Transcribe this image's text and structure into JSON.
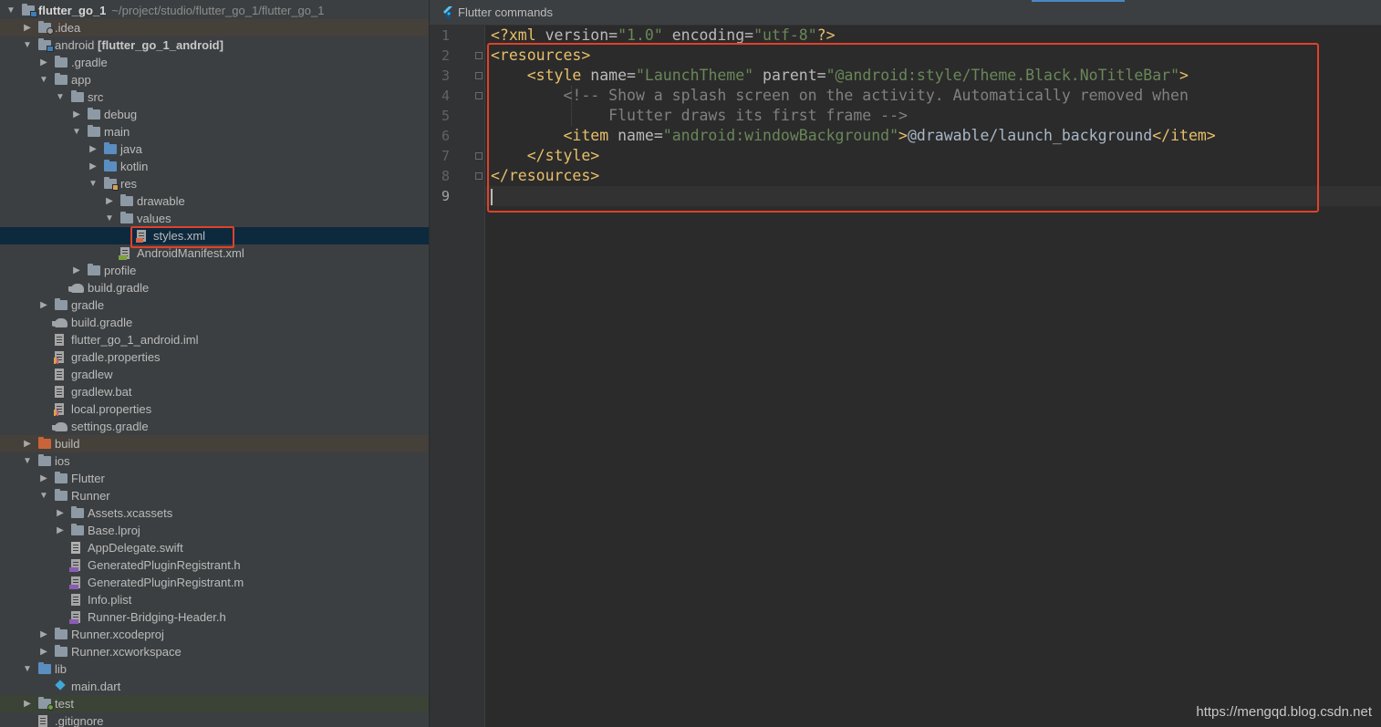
{
  "project_tree": {
    "rows": [
      {
        "label": "flutter_go_1",
        "sub": "~/project/studio/flutter_go_1/flutter_go_1",
        "bold": true,
        "depth": 0,
        "arrow": "open",
        "icon": "folder",
        "variant": "module",
        "state": ""
      },
      {
        "label": ".idea",
        "depth": 1,
        "arrow": "closed",
        "icon": "folder",
        "variant": "gear",
        "state": "excluded"
      },
      {
        "label": "android",
        "bracket": "[flutter_go_1_android]",
        "depth": 1,
        "arrow": "open",
        "icon": "folder",
        "variant": "module",
        "state": ""
      },
      {
        "label": ".gradle",
        "depth": 2,
        "arrow": "closed",
        "icon": "folder",
        "variant": "",
        "state": ""
      },
      {
        "label": "app",
        "depth": 2,
        "arrow": "open",
        "icon": "folder",
        "variant": "",
        "state": ""
      },
      {
        "label": "src",
        "depth": 3,
        "arrow": "open",
        "icon": "folder",
        "variant": "",
        "state": ""
      },
      {
        "label": "debug",
        "depth": 4,
        "arrow": "closed",
        "icon": "folder",
        "variant": "",
        "state": ""
      },
      {
        "label": "main",
        "depth": 4,
        "arrow": "open",
        "icon": "folder",
        "variant": "",
        "state": ""
      },
      {
        "label": "java",
        "depth": 5,
        "arrow": "closed",
        "icon": "folder",
        "variant": "blue",
        "state": ""
      },
      {
        "label": "kotlin",
        "depth": 5,
        "arrow": "closed",
        "icon": "folder",
        "variant": "blue",
        "state": ""
      },
      {
        "label": "res",
        "depth": 5,
        "arrow": "open",
        "icon": "folder",
        "variant": "res",
        "state": ""
      },
      {
        "label": "drawable",
        "depth": 6,
        "arrow": "closed",
        "icon": "folder",
        "variant": "",
        "state": ""
      },
      {
        "label": "values",
        "depth": 6,
        "arrow": "open",
        "icon": "folder",
        "variant": "",
        "state": ""
      },
      {
        "label": "styles.xml",
        "depth": 7,
        "arrow": "",
        "icon": "file",
        "variant": "xml",
        "state": "selected"
      },
      {
        "label": "AndroidManifest.xml",
        "depth": 6,
        "arrow": "",
        "icon": "file",
        "variant": "mf",
        "state": ""
      },
      {
        "label": "profile",
        "depth": 4,
        "arrow": "closed",
        "icon": "folder",
        "variant": "",
        "state": ""
      },
      {
        "label": "build.gradle",
        "depth": 3,
        "arrow": "",
        "icon": "elephant",
        "variant": "",
        "state": ""
      },
      {
        "label": "gradle",
        "depth": 2,
        "arrow": "closed",
        "icon": "folder",
        "variant": "",
        "state": ""
      },
      {
        "label": "build.gradle",
        "depth": 2,
        "arrow": "",
        "icon": "elephant",
        "variant": "",
        "state": ""
      },
      {
        "label": "flutter_go_1_android.iml",
        "depth": 2,
        "arrow": "",
        "icon": "file",
        "variant": "",
        "state": ""
      },
      {
        "label": "gradle.properties",
        "depth": 2,
        "arrow": "",
        "icon": "file",
        "variant": "chart",
        "state": ""
      },
      {
        "label": "gradlew",
        "depth": 2,
        "arrow": "",
        "icon": "file",
        "variant": "",
        "state": ""
      },
      {
        "label": "gradlew.bat",
        "depth": 2,
        "arrow": "",
        "icon": "file",
        "variant": "",
        "state": ""
      },
      {
        "label": "local.properties",
        "depth": 2,
        "arrow": "",
        "icon": "file",
        "variant": "chart",
        "state": ""
      },
      {
        "label": "settings.gradle",
        "depth": 2,
        "arrow": "",
        "icon": "elephant",
        "variant": "",
        "state": ""
      },
      {
        "label": "build",
        "depth": 1,
        "arrow": "closed",
        "icon": "folder",
        "variant": "orange",
        "state": "excluded"
      },
      {
        "label": "ios",
        "depth": 1,
        "arrow": "open",
        "icon": "folder",
        "variant": "",
        "state": ""
      },
      {
        "label": "Flutter",
        "depth": 2,
        "arrow": "closed",
        "icon": "folder",
        "variant": "",
        "state": ""
      },
      {
        "label": "Runner",
        "depth": 2,
        "arrow": "open",
        "icon": "folder",
        "variant": "",
        "state": ""
      },
      {
        "label": "Assets.xcassets",
        "depth": 3,
        "arrow": "closed",
        "icon": "folder",
        "variant": "",
        "state": ""
      },
      {
        "label": "Base.lproj",
        "depth": 3,
        "arrow": "closed",
        "icon": "folder",
        "variant": "",
        "state": ""
      },
      {
        "label": "AppDelegate.swift",
        "depth": 3,
        "arrow": "",
        "icon": "file",
        "variant": "swift",
        "state": ""
      },
      {
        "label": "GeneratedPluginRegistrant.h",
        "depth": 3,
        "arrow": "",
        "icon": "file",
        "variant": "hdr",
        "state": ""
      },
      {
        "label": "GeneratedPluginRegistrant.m",
        "depth": 3,
        "arrow": "",
        "icon": "file",
        "variant": "hdr",
        "state": ""
      },
      {
        "label": "Info.plist",
        "depth": 3,
        "arrow": "",
        "icon": "file",
        "variant": "",
        "state": ""
      },
      {
        "label": "Runner-Bridging-Header.h",
        "depth": 3,
        "arrow": "",
        "icon": "file",
        "variant": "hdr",
        "state": ""
      },
      {
        "label": "Runner.xcodeproj",
        "depth": 2,
        "arrow": "closed",
        "icon": "folder",
        "variant": "",
        "state": ""
      },
      {
        "label": "Runner.xcworkspace",
        "depth": 2,
        "arrow": "closed",
        "icon": "folder",
        "variant": "",
        "state": ""
      },
      {
        "label": "lib",
        "depth": 1,
        "arrow": "open",
        "icon": "folder",
        "variant": "blue",
        "state": ""
      },
      {
        "label": "main.dart",
        "depth": 2,
        "arrow": "",
        "icon": "dart",
        "variant": "",
        "state": ""
      },
      {
        "label": "test",
        "depth": 1,
        "arrow": "closed",
        "icon": "folder",
        "variant": "test",
        "state": "test"
      },
      {
        "label": ".gitignore",
        "depth": 1,
        "arrow": "",
        "icon": "file",
        "variant": "",
        "state": ""
      }
    ]
  },
  "editor": {
    "tab_label": "Flutter commands",
    "line_numbers": [
      "1",
      "2",
      "3",
      "4",
      "5",
      "6",
      "7",
      "8",
      "9"
    ],
    "current_line": "9",
    "lines": [
      {
        "tokens": [
          {
            "c": "t",
            "v": "<?xml "
          },
          {
            "c": "a",
            "v": "version="
          },
          {
            "c": "s",
            "v": "\"1.0\""
          },
          {
            "c": "a",
            "v": " encoding="
          },
          {
            "c": "s",
            "v": "\"utf-8\""
          },
          {
            "c": "t",
            "v": "?>"
          }
        ]
      },
      {
        "tokens": [
          {
            "c": "t",
            "v": "<resources>"
          }
        ]
      },
      {
        "tokens": [
          {
            "c": "p",
            "v": "    "
          },
          {
            "c": "t",
            "v": "<style "
          },
          {
            "c": "a",
            "v": "name="
          },
          {
            "c": "s",
            "v": "\"LaunchTheme\""
          },
          {
            "c": "a",
            "v": " parent="
          },
          {
            "c": "s",
            "v": "\"@android:style/Theme.Black.NoTitleBar\""
          },
          {
            "c": "t",
            "v": ">"
          }
        ]
      },
      {
        "tokens": [
          {
            "c": "c",
            "v": "        <!-- Show a splash screen on the activity. Automatically removed when"
          }
        ]
      },
      {
        "tokens": [
          {
            "c": "c",
            "v": "             Flutter draws its first frame -->"
          }
        ]
      },
      {
        "tokens": [
          {
            "c": "p",
            "v": "        "
          },
          {
            "c": "t",
            "v": "<item "
          },
          {
            "c": "a",
            "v": "name="
          },
          {
            "c": "s",
            "v": "\"android:windowBackground\""
          },
          {
            "c": "t",
            "v": ">"
          },
          {
            "c": "p",
            "v": "@drawable/launch_background"
          },
          {
            "c": "t",
            "v": "</item>"
          }
        ]
      },
      {
        "tokens": [
          {
            "c": "p",
            "v": "    "
          },
          {
            "c": "t",
            "v": "</style>"
          }
        ]
      },
      {
        "tokens": [
          {
            "c": "t",
            "v": "</resources>"
          }
        ]
      },
      {
        "tokens": []
      }
    ]
  },
  "watermark": "https://mengqd.blog.csdn.net"
}
